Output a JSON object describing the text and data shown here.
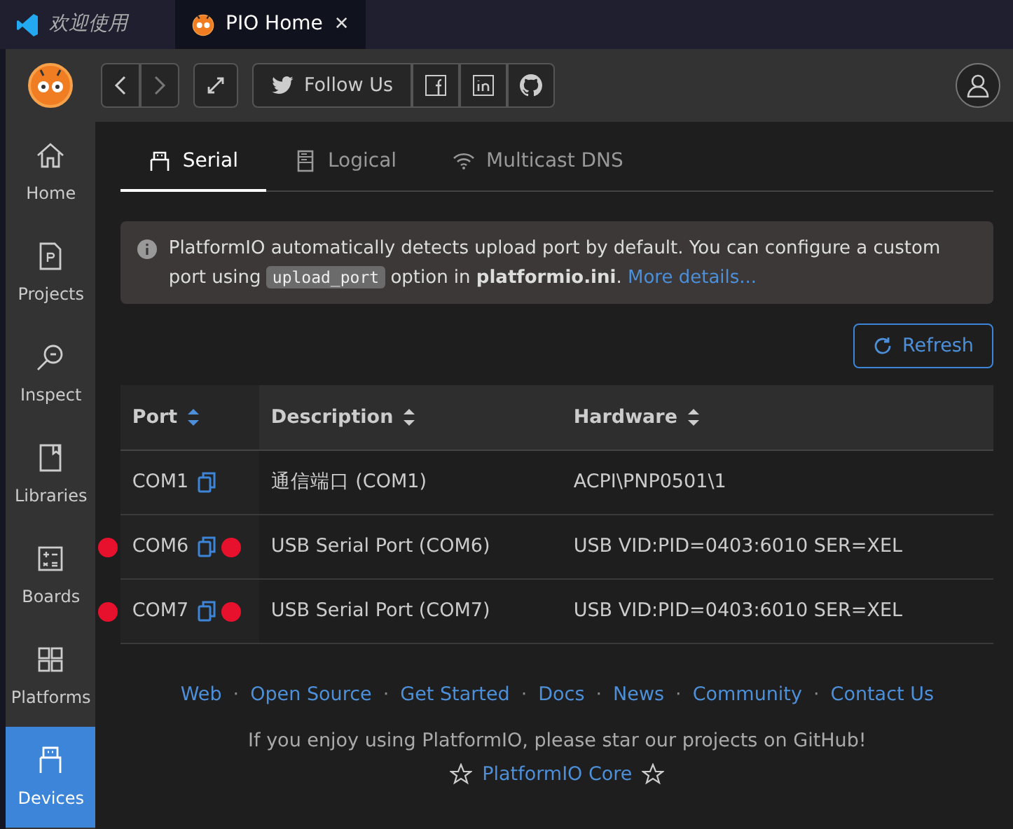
{
  "editor_tabs": [
    {
      "label": "欢迎使用",
      "kind": "vscode",
      "selected": false,
      "italic": true
    },
    {
      "label": "PIO Home",
      "kind": "pio",
      "selected": true,
      "italic": false,
      "close": "✕"
    }
  ],
  "toolbar": {
    "follow": "Follow Us"
  },
  "sidebar": {
    "items": [
      {
        "label": "Home",
        "kind": "home",
        "selected": false
      },
      {
        "label": "Projects",
        "kind": "projects",
        "selected": false
      },
      {
        "label": "Inspect",
        "kind": "inspect",
        "selected": false
      },
      {
        "label": "Libraries",
        "kind": "libraries",
        "selected": false
      },
      {
        "label": "Boards",
        "kind": "boards",
        "selected": false
      },
      {
        "label": "Platforms",
        "kind": "platforms",
        "selected": false
      },
      {
        "label": "Devices",
        "kind": "devices",
        "selected": true
      }
    ]
  },
  "tabs": [
    {
      "label": "Serial",
      "kind": "serial",
      "selected": true
    },
    {
      "label": "Logical",
      "kind": "logical",
      "selected": false
    },
    {
      "label": "Multicast DNS",
      "kind": "wifi",
      "selected": false
    }
  ],
  "alert": {
    "text_before": "PlatformIO automatically detects upload port by default. You can configure a custom port using",
    "code": "upload_port",
    "text_after": "option in **platformio.ini**.",
    "link": "More details..."
  },
  "refresh_button": "Refresh",
  "table": {
    "columns": [
      "Port",
      "Description",
      "Hardware"
    ],
    "rows": [
      {
        "port": "COM1",
        "description": "通信端口 (COM1)",
        "hardware": "ACPI\\PNP0501\\1",
        "marked": false
      },
      {
        "port": "COM6",
        "description": "USB Serial Port (COM6)",
        "hardware": "USB VID:PID=0403:6010 SER=XEL",
        "marked": true
      },
      {
        "port": "COM7",
        "description": "USB Serial Port (COM7)",
        "hardware": "USB VID:PID=0403:6010 SER=XEL",
        "marked": true
      }
    ]
  },
  "footer": {
    "separator": "·",
    "links": [
      "Web",
      "Open Source",
      "Get Started",
      "Docs",
      "News",
      "Community",
      "Contact Us"
    ],
    "message": "If you enjoy using PlatformIO, please star our projects on GitHub!",
    "core_link": "PlatformIO Core"
  }
}
